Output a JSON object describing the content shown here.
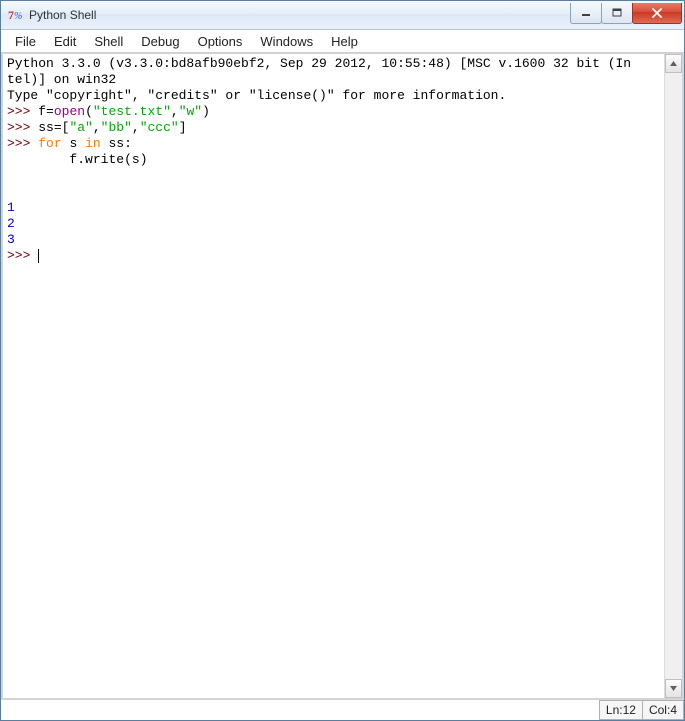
{
  "window": {
    "title": "Python Shell"
  },
  "menubar": {
    "items": [
      "File",
      "Edit",
      "Shell",
      "Debug",
      "Options",
      "Windows",
      "Help"
    ]
  },
  "shell": {
    "banner_line1": "Python 3.3.0 (v3.3.0:bd8afb90ebf2, Sep 29 2012, 10:55:48) [MSC v.1600 32 bit (In",
    "banner_line2": "tel)] on win32",
    "banner_line3": "Type \"copyright\", \"credits\" or \"license()\" for more information.",
    "prompt": ">>> ",
    "line1": {
      "ident": "f",
      "eq": "=",
      "builtin": "open",
      "lp": "(",
      "arg1": "\"test.txt\"",
      "comma": ",",
      "arg2": "\"w\"",
      "rp": ")"
    },
    "line2": {
      "ident": "ss",
      "eq": "=",
      "lb": "[",
      "s1": "\"a\"",
      "c1": ",",
      "s2": "\"bb\"",
      "c2": ",",
      "s3": "\"ccc\"",
      "rb": "]"
    },
    "line3": {
      "for": "for",
      "space1": " ",
      "var": "s",
      "space2": " ",
      "in": "in",
      "space3": " ",
      "iter": "ss",
      "colon": ":"
    },
    "line4_indent": "        ",
    "line4": {
      "obj": "f",
      "dot": ".",
      "method": "write",
      "lp": "(",
      "arg": "s",
      "rp": ")"
    },
    "blank": "",
    "out1": "1",
    "out2": "2",
    "out3": "3"
  },
  "status": {
    "line_label": "Ln: ",
    "line_value": "12",
    "col_label": "Col: ",
    "col_value": "4"
  }
}
